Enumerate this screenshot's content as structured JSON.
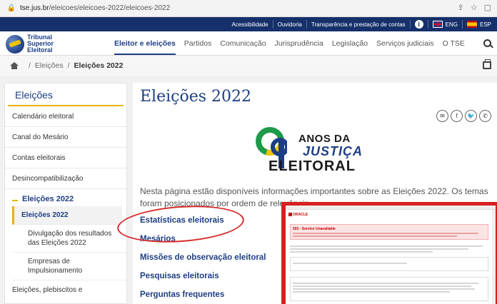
{
  "browser": {
    "url_host": "tse.jus.br",
    "url_path": "/eleicoes/eleicoes-2022/eleicoes-2022"
  },
  "topbar": {
    "links": [
      "Acessibilidade",
      "Ouvidoria",
      "Transparência e prestação de contas"
    ],
    "lang_en": "ENG",
    "lang_es": "ESP",
    "info": "i"
  },
  "logo": {
    "line1": "Tribunal",
    "line2": "Superior",
    "line3": "Eleitoral"
  },
  "nav": {
    "items": [
      "Eleitor e eleições",
      "Partidos",
      "Comunicação",
      "Jurisprudência",
      "Legislação",
      "Serviços judiciais",
      "O TSE"
    ]
  },
  "breadcrumb": {
    "item1": "Eleições",
    "item2": "Eleições 2022",
    "sep": "/"
  },
  "sidebar": {
    "title": "Eleições",
    "items": [
      "Calendário eleitoral",
      "Canal do Mesário",
      "Contas eleitorais",
      "Desincompatibilização"
    ],
    "group_title": "Eleições 2022",
    "active_sub": "Eleições 2022",
    "sub1_line1": "Divulgação dos resultados",
    "sub1_line2": "das Eleições 2022",
    "sub2_line1": "Empresas de",
    "sub2_line2": "Impulsionamento",
    "truncated": "Eleições, plebiscitos e"
  },
  "main": {
    "title": "Eleições 2022",
    "share": [
      "✉",
      "f",
      "🐦",
      "✆"
    ],
    "banner_line1": "ANOS DA",
    "banner_line2": "JUSTIÇA",
    "banner_line3": "ELEITORAL",
    "intro": "Nesta página estão disponíveis informações importantes sobre as Eleições 2022. Os temas foram posicionados por ordem de relevância.",
    "links": [
      "Estatísticas eleitorais",
      "Mesários",
      "Missões de observação eleitoral",
      "Pesquisas eleitorais",
      "Perguntas frequentes"
    ]
  },
  "inset": {
    "brand": "ORACLE",
    "alert_heading": "503 - Service Unavailable"
  },
  "colors": {
    "brand_blue": "#1d3e84",
    "top_strip": "#15306a",
    "accent_yellow": "#e6b400",
    "annotation_red": "#d72a2a"
  }
}
